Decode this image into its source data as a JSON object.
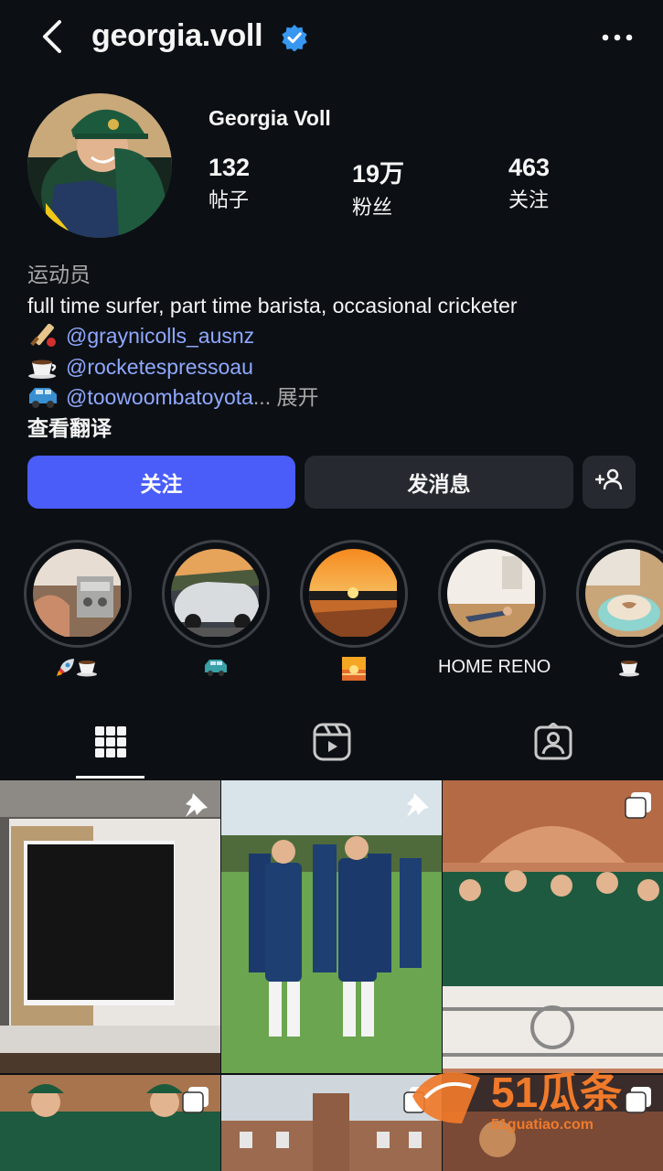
{
  "header": {
    "username": "georgia.voll",
    "back_icon": "back-arrow-icon",
    "verified_icon": "verified-badge-icon",
    "more_icon": "more-options-icon"
  },
  "profile": {
    "display_name": "Georgia Voll",
    "stats": [
      {
        "value": "132",
        "label": "帖子"
      },
      {
        "value": "19万",
        "label": "粉丝"
      },
      {
        "value": "463",
        "label": "关注"
      }
    ]
  },
  "bio": {
    "category": "运动员",
    "text": "full time surfer, part time barista, occasional cricketer",
    "links": [
      {
        "emoji_icon": "cricket-icon",
        "handle": "@graynicolls_ausnz"
      },
      {
        "emoji_icon": "coffee-icon",
        "handle": "@rocketespressoau"
      },
      {
        "emoji_icon": "car-icon",
        "handle": "@toowoombatoyota"
      }
    ],
    "ellipsis": "...",
    "expand": "展开",
    "translate": "查看翻译"
  },
  "actions": {
    "follow": "关注",
    "message": "发消息",
    "add_user_icon": "add-person-icon"
  },
  "highlights": [
    {
      "label": "🚀☕",
      "icons": [
        "rocket-icon",
        "coffee-icon"
      ]
    },
    {
      "label": "🚙",
      "icons": [
        "car-icon"
      ]
    },
    {
      "label": "🌅",
      "icons": [
        "sunrise-icon"
      ]
    },
    {
      "label": "HOME RENO",
      "icons": []
    },
    {
      "label": "☕",
      "icons": [
        "coffee-icon"
      ]
    }
  ],
  "tabs": [
    {
      "name": "posts-grid",
      "icon": "grid-icon",
      "active": true
    },
    {
      "name": "reels",
      "icon": "reels-icon",
      "active": false
    },
    {
      "name": "tagged",
      "icon": "tagged-icon",
      "active": false
    }
  ],
  "watermark": {
    "brand": "51瓜条",
    "url": "51guatiao.com"
  },
  "colors": {
    "background": "#0c1014",
    "accent": "#4a5df9",
    "link": "#8fa8ff",
    "button_secondary": "#262a30",
    "verified": "#3897f0"
  }
}
